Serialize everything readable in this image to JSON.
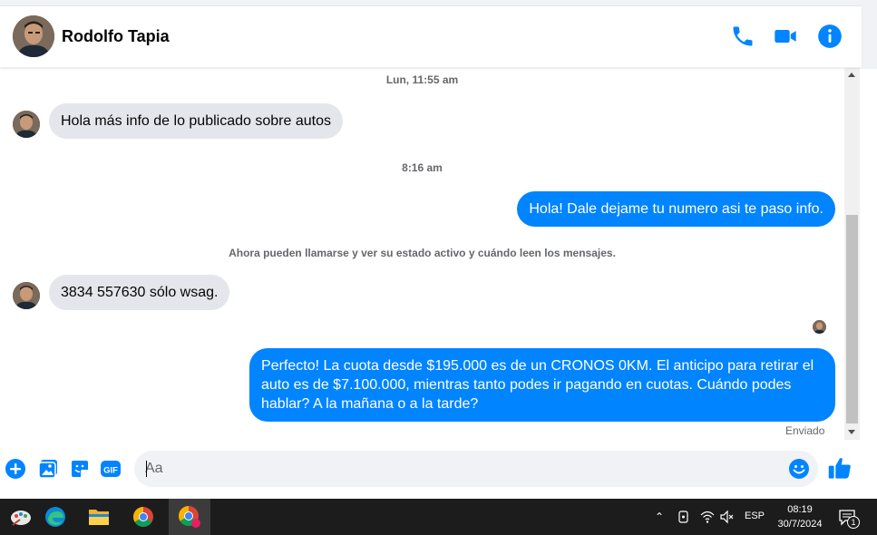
{
  "header": {
    "contact_name": "Rodolfo Tapia",
    "icons": [
      "phone-icon",
      "video-icon",
      "info-icon"
    ],
    "accent_color": "#0084ff"
  },
  "conversation": {
    "timestamp_1": "Lun, 11:55 am",
    "msg_1": "Hola  más info de lo publicado sobre autos",
    "timestamp_2": "8:16 am",
    "msg_2": "Hola! Dale dejame tu numero  asi te paso info.",
    "system_notice": "Ahora pueden llamarse y ver su estado activo y cuándo leen los mensajes.",
    "msg_3": "3834 557630  sólo wsag.",
    "msg_4": "Perfecto! La cuota desde $195.000 es de un CRONOS 0KM. El anticipo para retirar el auto es de $7.100.000, mientras tanto podes ir pagando en cuotas. Cuándo podes hablar? A la mañana o a la tarde?",
    "delivery_status": "Enviado"
  },
  "composer": {
    "placeholder": "Aa",
    "icons": [
      "plus-icon",
      "photo-icon",
      "sticker-icon",
      "gif-icon",
      "emoji-icon",
      "like-icon"
    ],
    "gif_label": "GIF"
  },
  "taskbar": {
    "language": "ESP",
    "time": "08:19",
    "date": "30/7/2024",
    "notification_count": "1",
    "apps": [
      "paint-icon",
      "edge-icon",
      "file-explorer-icon",
      "chrome-icon",
      "chrome-profile-icon"
    ]
  }
}
